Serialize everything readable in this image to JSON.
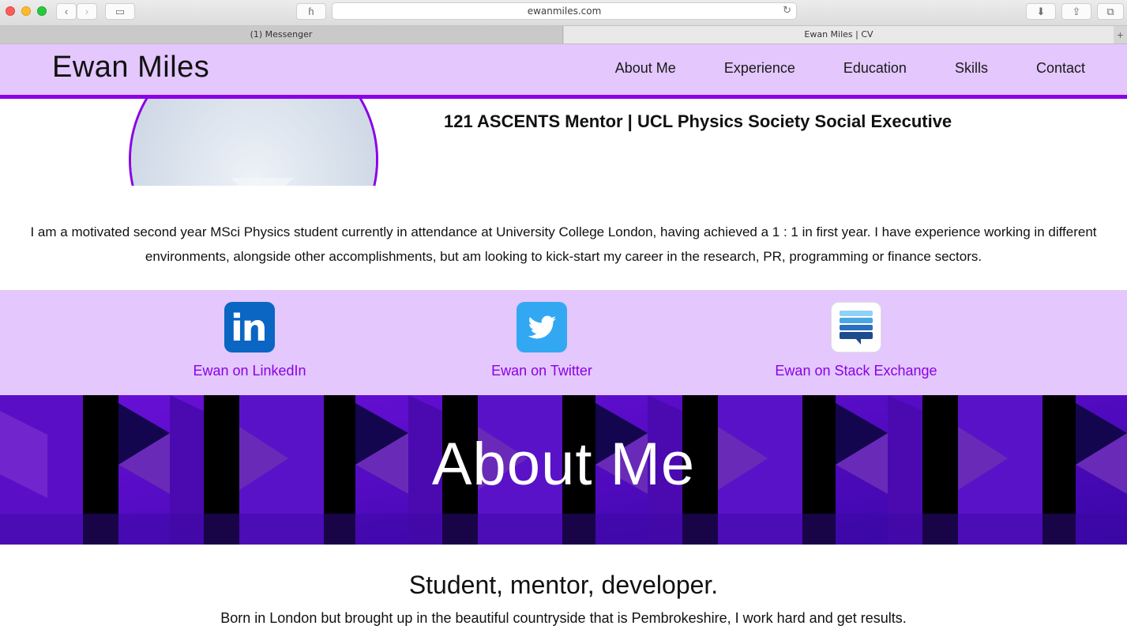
{
  "browser": {
    "url": "ewanmiles.com",
    "tabs": [
      {
        "label": "(1) Messenger"
      },
      {
        "label": "Ewan Miles | CV"
      }
    ]
  },
  "site": {
    "brand": "Ewan Miles",
    "nav": [
      "About Me",
      "Experience",
      "Education",
      "Skills",
      "Contact"
    ],
    "accent_color": "#8a00e6",
    "band_color": "#e3c7fd"
  },
  "profile": {
    "role": "121 ASCENTS Mentor | UCL Physics Society Social Executive",
    "intro": "I am a motivated second year MSci Physics student currently in attendance at University College London, having achieved a 1 : 1 in first year. I have experience working in different environments, alongside other accomplishments, but am looking to kick-start my career in the research, PR, programming or finance sectors."
  },
  "social": [
    {
      "icon": "linkedin-icon",
      "label": "Ewan on LinkedIn"
    },
    {
      "icon": "twitter-icon",
      "label": "Ewan on Twitter"
    },
    {
      "icon": "stack-exchange-icon",
      "label": "Ewan on Stack Exchange"
    }
  ],
  "about": {
    "heading": "About Me",
    "tagline": "Student, mentor, developer.",
    "bio": "Born in London but brought up in the beautiful countryside that is Pembrokeshire, I work hard and get results."
  }
}
